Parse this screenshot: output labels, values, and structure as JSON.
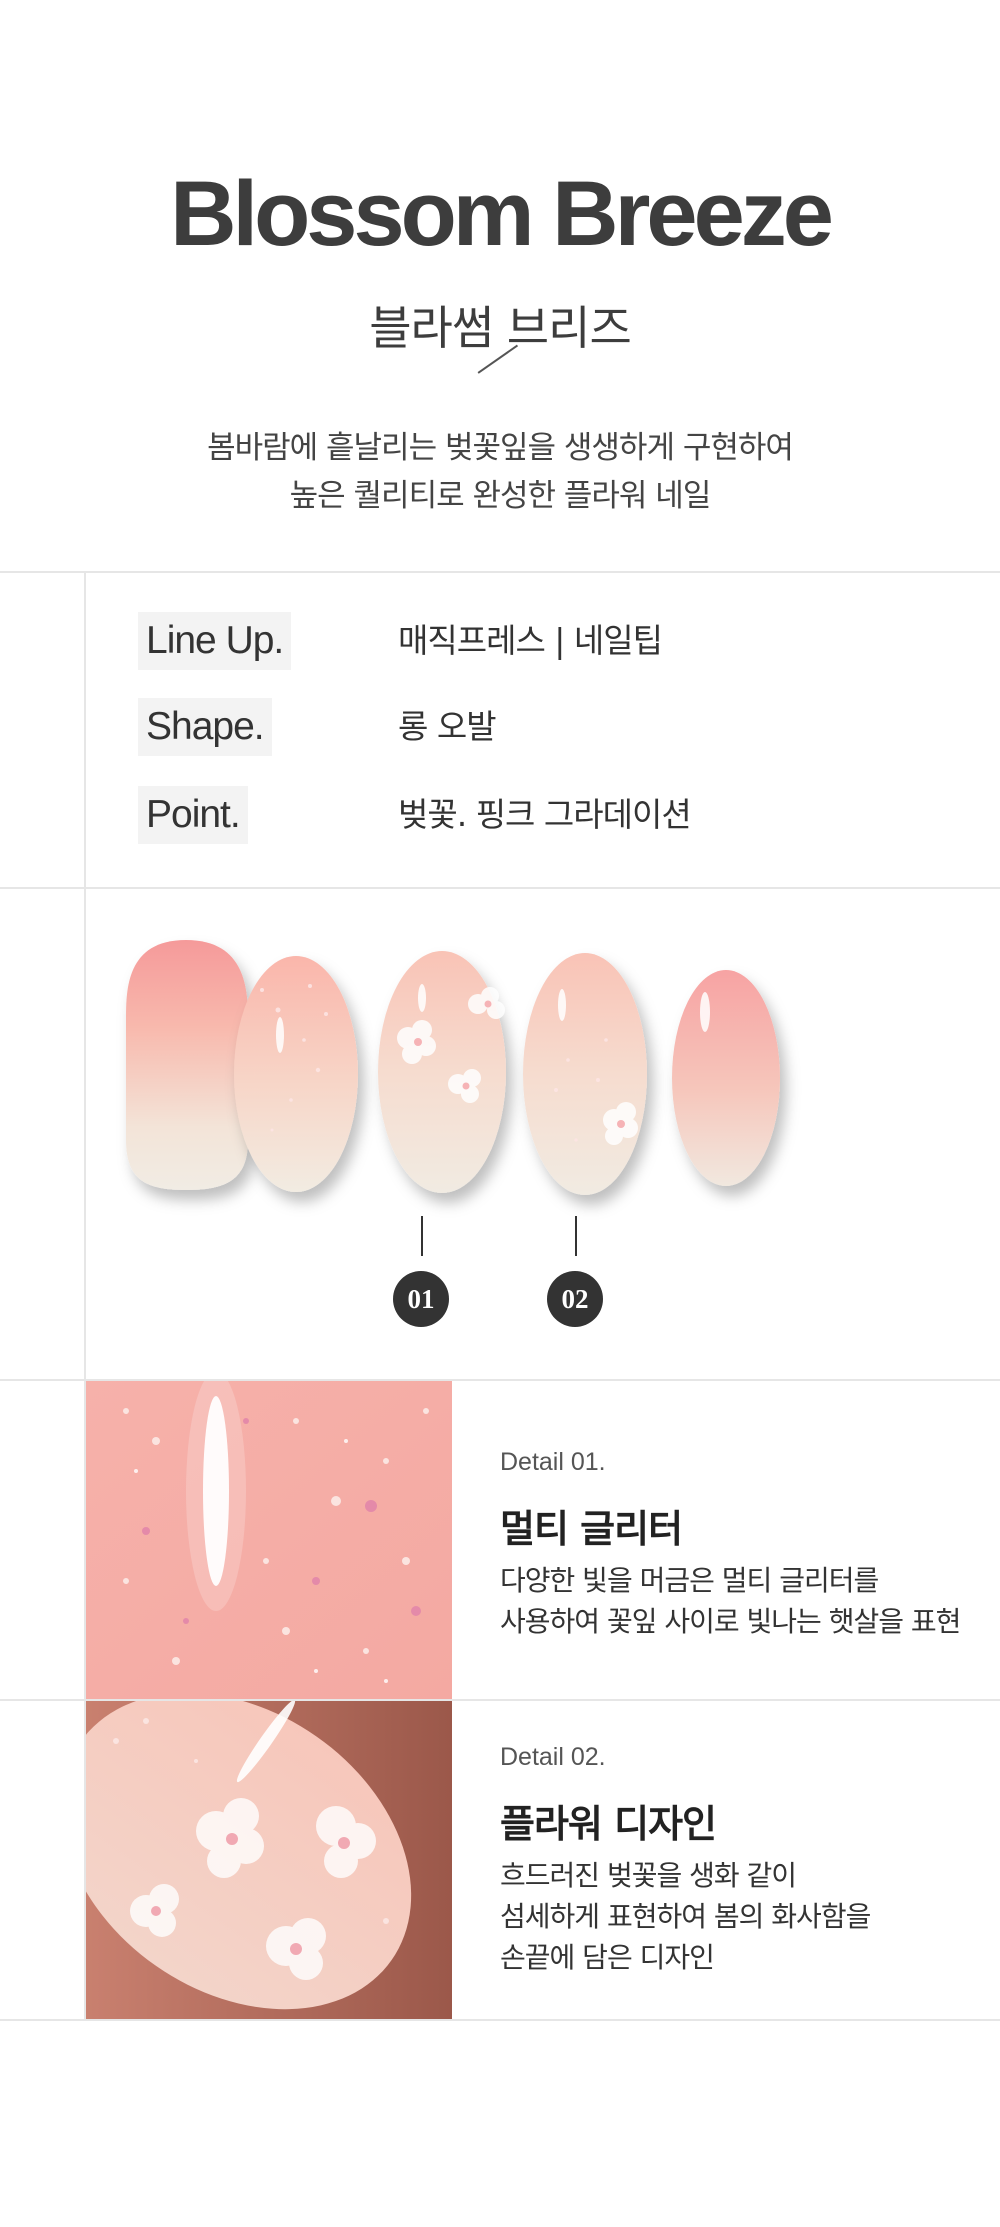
{
  "header": {
    "title": "Blossom Breeze",
    "subtitle": "블라썸 브리즈",
    "tagline_line1": "봄바람에 흩날리는 벚꽃잎을 생생하게 구현하여",
    "tagline_line2": "높은 퀄리티로 완성한 플라워 네일"
  },
  "specs": [
    {
      "label": "Line Up.",
      "value": "매직프레스 | 네일팁"
    },
    {
      "label": "Shape.",
      "value": "롱 오발"
    },
    {
      "label": "Point.",
      "value": "벚꽃. 핑크 그라데이션"
    }
  ],
  "markers": [
    "01",
    "02"
  ],
  "details": [
    {
      "kicker": "Detail 01.",
      "heading": "멀티 글리터",
      "desc": "다양한 빛을 머금은 멀티 글리터를\n사용하여 꽃잎 사이로 빛나는 햇살을 표현"
    },
    {
      "kicker": "Detail 02.",
      "heading": "플라워 디자인",
      "desc": "흐드러진 벚꽃을 생화 같이\n섬세하게 표현하여 봄의 화사함을\n손끝에 담은 디자인"
    }
  ],
  "colors": {
    "text": "#3d3d3d",
    "rule": "#e6e6e6",
    "nail_pink": "#f4a3a3",
    "nail_cream": "#f5ede2"
  }
}
